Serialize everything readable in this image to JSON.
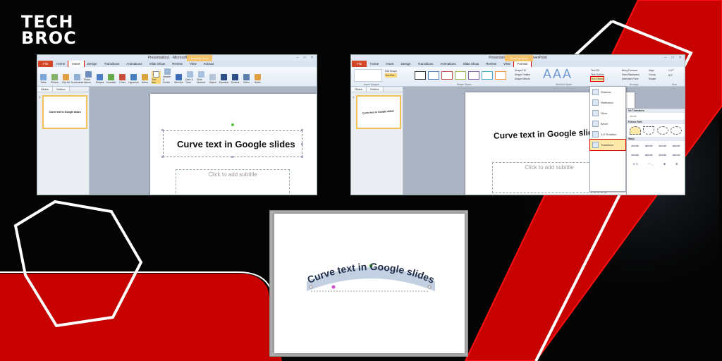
{
  "brand": {
    "line1": "TECH",
    "line2": "BROC"
  },
  "colors": {
    "brand_red": "#c70000",
    "bg": "#040404",
    "highlight_red": "#e00000"
  },
  "shot1": {
    "window_title": "Presentation1 - Microsoft PowerPoint",
    "context_tab": "Drawing Tools",
    "tabs": [
      "File",
      "Home",
      "Insert",
      "Design",
      "Transitions",
      "Animations",
      "Slide Show",
      "Review",
      "View",
      "Format"
    ],
    "highlighted_tab": "Insert",
    "ribbon_buttons": [
      "Table",
      "Picture",
      "Clip Art",
      "Screenshot",
      "Photo Album",
      "Shapes",
      "SmartArt",
      "Chart",
      "Hyperlink",
      "Action",
      "Text Box",
      "Header & Footer",
      "WordArt",
      "Date & Time",
      "Slide Number",
      "Object",
      "Equation",
      "Symbol",
      "Video",
      "Audio"
    ],
    "groups": [
      "Tables",
      "Images",
      "Illustrations",
      "Links",
      "Text",
      "Symbols",
      "Media"
    ],
    "pane_tabs": [
      "Slides",
      "Outline"
    ],
    "slide_number": "1",
    "thumb_text": "Curve text in Google slides",
    "title_text": "Curve text in Google slides",
    "subtitle_placeholder": "Click to add subtitle"
  },
  "shot2": {
    "window_title": "Presentation1 - Microsoft PowerPoint",
    "context_tab": "Drawing Tools",
    "tabs": [
      "File",
      "Home",
      "Insert",
      "Design",
      "Transitions",
      "Animations",
      "Slide Show",
      "Review",
      "View",
      "Format"
    ],
    "highlighted_tab": "Format",
    "ribbon_small": [
      "Edit Shape",
      "Text Box",
      "Shape Fill",
      "Shape Outline",
      "Shape Effects",
      "Text Fill",
      "Text Outline",
      "Text Effects",
      "Bring Forward",
      "Send Backward",
      "Selection Pane",
      "Align",
      "Group",
      "Rotate"
    ],
    "groups": [
      "Insert Shapes",
      "Shape Styles",
      "WordArt Styles",
      "Arrange",
      "Size"
    ],
    "size_values": [
      "1.07\"",
      "8.5\""
    ],
    "pane_tabs": [
      "Slides",
      "Outline"
    ],
    "slide_number": "1",
    "thumb_text": "Curve text in Google slides",
    "title_text": "Curve text in Google slides",
    "subtitle_placeholder": "Click to add subtitle",
    "text_effects_menu": [
      "Shadow",
      "Reflection",
      "Glow",
      "Bevel",
      "3-D Rotation",
      "Transform"
    ],
    "active_menu_item": "Transform",
    "flyout_sections": [
      "No Transform",
      "Follow Path",
      "Warp"
    ],
    "no_transform_sample": "abcde",
    "warp_samples": [
      "abcde",
      "abcde",
      "abcde",
      "abcde",
      "abcde",
      "abcde",
      "abcde",
      "abcde"
    ]
  },
  "shot3": {
    "curved_text": "Curve text in Google slides"
  }
}
